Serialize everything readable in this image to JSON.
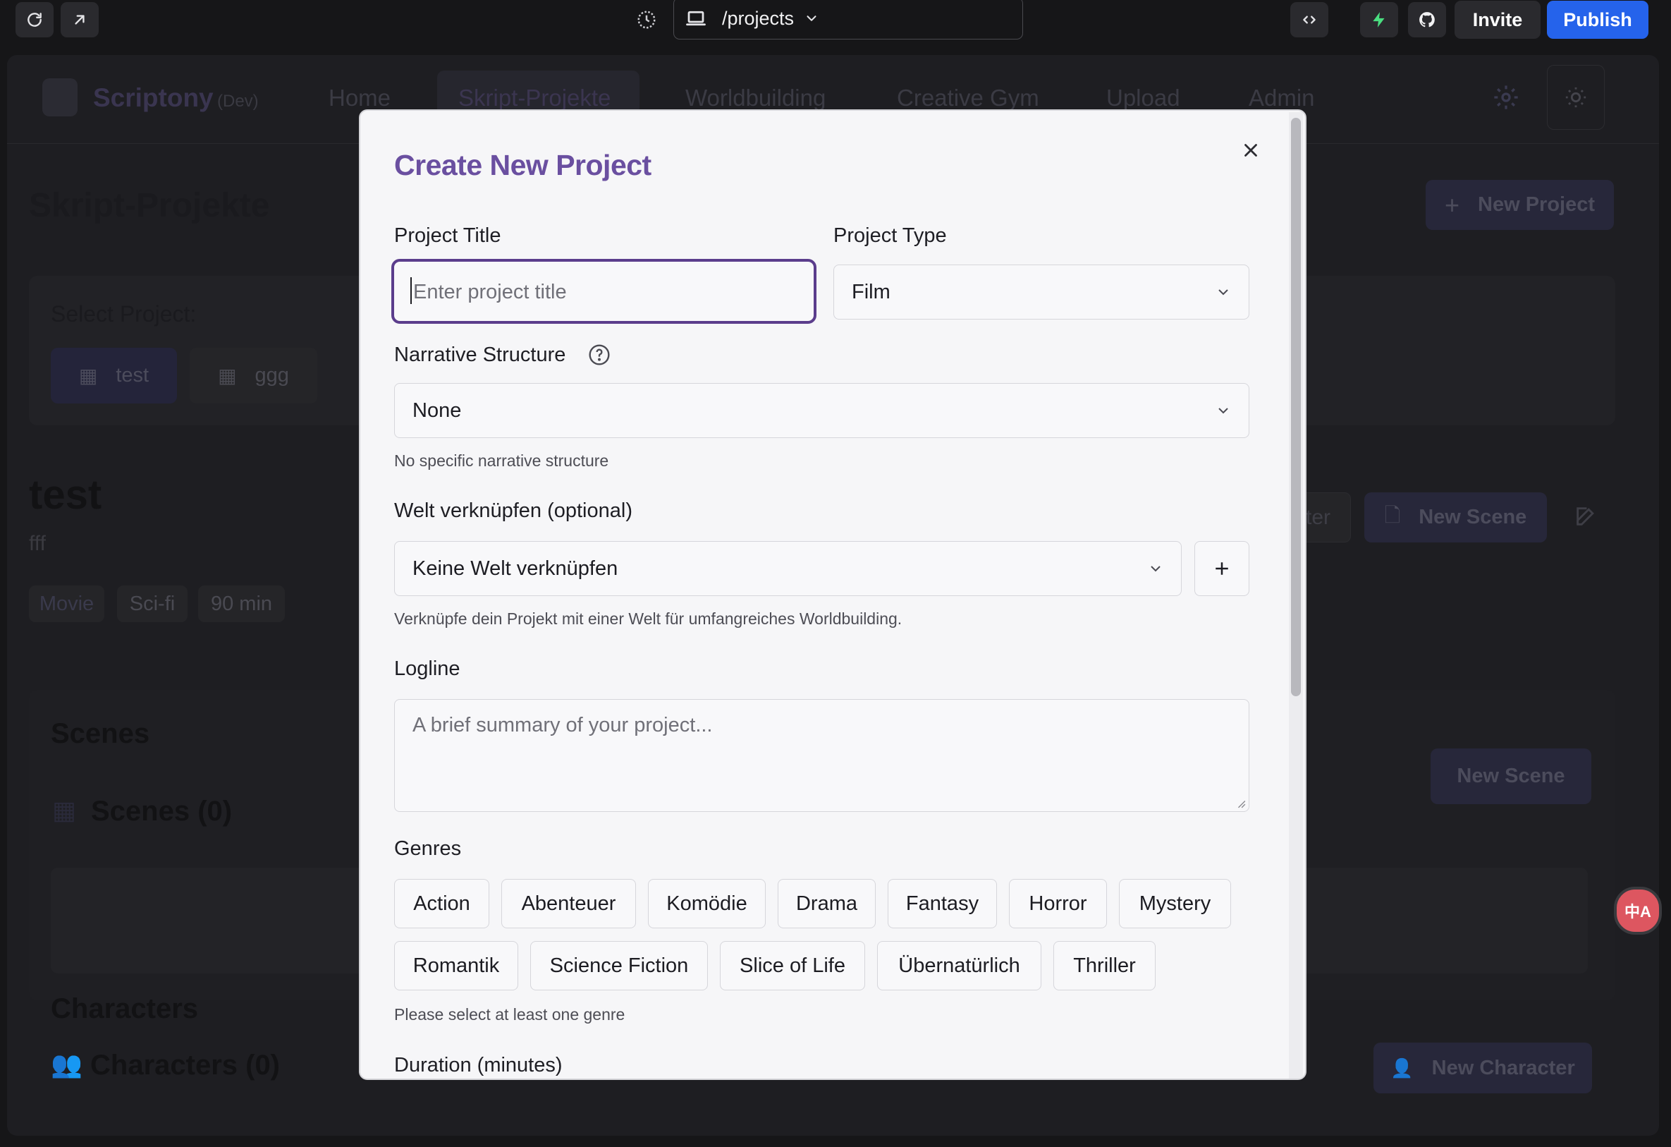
{
  "browser": {
    "url": "/projects",
    "invite_label": "Invite",
    "publish_label": "Publish",
    "colors": {
      "publish": "#2563eb",
      "bolt": "#4ade80"
    }
  },
  "app": {
    "brand": "Scriptony",
    "env": "(Dev)",
    "nav": [
      "Home",
      "Skript-Projekte",
      "Worldbuilding",
      "Creative Gym",
      "Upload",
      "Admin"
    ],
    "page_title": "Skript-Projekte",
    "new_project_label": "New Project",
    "select_project_label": "Select Project:",
    "projects": [
      "test",
      "ggg"
    ],
    "project": {
      "title": "test",
      "subtitle": "fff",
      "tags": [
        "Movie",
        "Sci-fi",
        "90 min"
      ]
    },
    "partial_button_label": "ter",
    "new_scene_label": "New Scene",
    "scenes_heading": "Scenes",
    "scenes_count": "Scenes (0)",
    "characters_heading": "Characters",
    "characters_count": "Characters (0)",
    "new_character_label": "New Character"
  },
  "modal": {
    "title": "Create New Project",
    "project_title_label": "Project Title",
    "project_title_placeholder": "Enter project title",
    "project_type_label": "Project Type",
    "project_type_value": "Film",
    "narrative_label": "Narrative Structure",
    "narrative_value": "None",
    "narrative_helper": "No specific narrative structure",
    "world_label": "Welt verknüpfen (optional)",
    "world_value": "Keine Welt verknüpfen",
    "world_helper": "Verknüpfe dein Projekt mit einer Welt für umfangreiches Worldbuilding.",
    "logline_label": "Logline",
    "logline_placeholder": "A brief summary of your project...",
    "genres_label": "Genres",
    "genres": [
      "Action",
      "Abenteuer",
      "Komödie",
      "Drama",
      "Fantasy",
      "Horror",
      "Mystery",
      "Romantik",
      "Science Fiction",
      "Slice of Life",
      "Übernatürlich",
      "Thriller"
    ],
    "genres_helper": "Please select at least one genre",
    "duration_label": "Duration (minutes)",
    "accent": "#6a4fa0"
  },
  "translate_badge": "中A"
}
